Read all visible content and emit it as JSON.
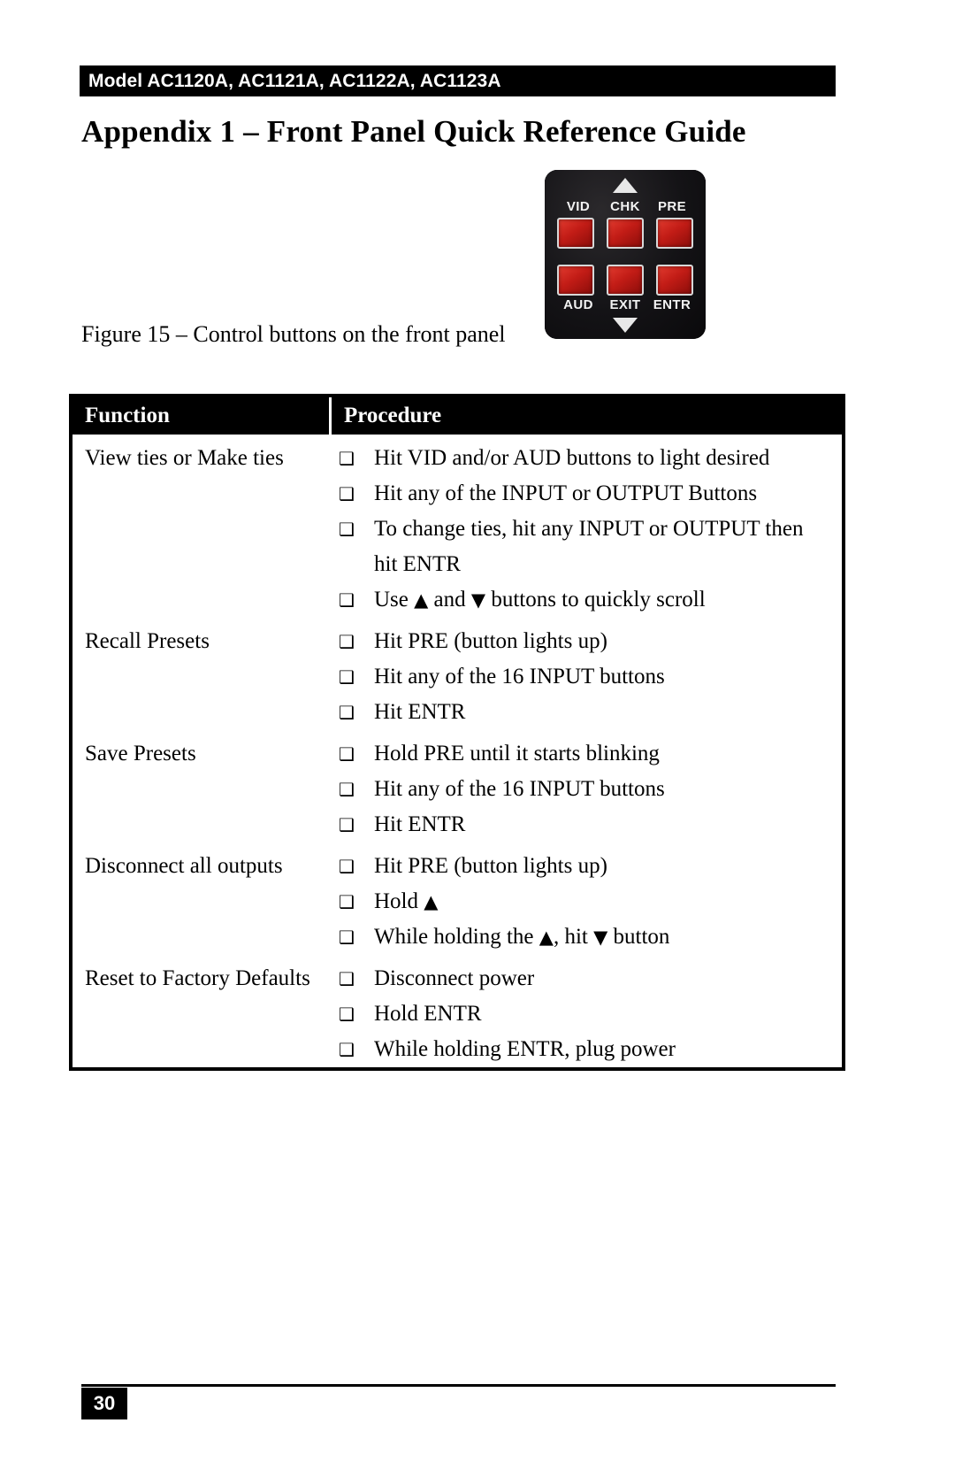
{
  "header": {
    "running_head": "Model AC1120A, AC1121A, AC1122A, AC1123A"
  },
  "title": "Appendix 1 – Front Panel Quick Reference Guide",
  "figure": {
    "caption": "Figure 15 – Control buttons on the front panel",
    "panel": {
      "up_arrow": "▲",
      "down_arrow": "▼",
      "top_labels": [
        "VID",
        "CHK",
        "PRE"
      ],
      "bottom_labels": [
        "AUD",
        "EXIT",
        "ENTR"
      ],
      "button_color": "#c21c16",
      "body_color": "#111013",
      "label_color": "#f2f2f2"
    }
  },
  "table": {
    "headers": {
      "function": "Function",
      "procedure": "Procedure"
    },
    "bullet_glyph": "❑",
    "rows": [
      {
        "function": "View ties or Make ties",
        "procedures": [
          "Hit VID and/or AUD buttons to light desired",
          "Hit any of the INPUT or OUTPUT Buttons",
          "To change ties, hit any INPUT or OUTPUT then hit ENTR",
          "Use ▲ and ▼ buttons to quickly scroll"
        ]
      },
      {
        "function": "Recall Presets",
        "procedures": [
          "Hit PRE (button lights up)",
          "Hit any of the 16 INPUT buttons",
          "Hit ENTR"
        ]
      },
      {
        "function": "Save Presets",
        "procedures": [
          "Hold PRE until it starts blinking",
          "Hit any of the 16 INPUT buttons",
          "Hit ENTR"
        ]
      },
      {
        "function": "Disconnect all outputs",
        "procedures": [
          "Hit PRE (button lights up)",
          "Hold ▲",
          "While holding the ▲, hit ▼ button"
        ]
      },
      {
        "function": "Reset to Factory Defaults",
        "procedures": [
          "Disconnect power",
          "Hold ENTR",
          "While holding ENTR, plug power"
        ]
      }
    ]
  },
  "footer": {
    "page_number": "30"
  }
}
